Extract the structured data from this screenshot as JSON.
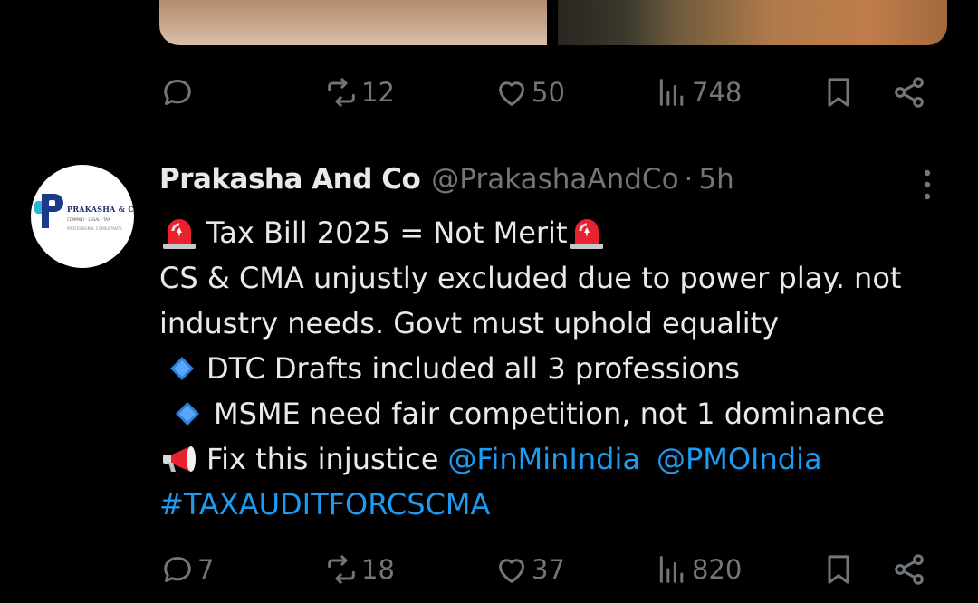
{
  "prev_tweet": {
    "actions": {
      "replies": "",
      "reposts": "12",
      "likes": "50",
      "views": "748"
    }
  },
  "tweet": {
    "avatar_text": {
      "name": "PRAKASHA & CO",
      "sub1": "COMPANY · LEGAL · TAX",
      "sub2": "PROFESSIONAL CONSULTANTS"
    },
    "author_name": "Prakasha And Co",
    "handle": "@PrakashaAndCo",
    "separator": "·",
    "time": "5h",
    "lines": {
      "l1": "Tax Bill 2025 = Not Merit",
      "l2": "CS & CMA unjustly excluded due to power play. not",
      "l3": "industry needs. Govt must uphold equality",
      "l4": "DTC Drafts included all 3 professions",
      "l5": "MSME need fair competition, not 1 dominance",
      "l6": "Fix this injustice",
      "mention1": "@FinMinIndia",
      "mention2": "@PMOIndia",
      "hashtag": "#TAXAUDITFORCSCMA"
    },
    "actions": {
      "replies": "7",
      "reposts": "18",
      "likes": "37",
      "views": "820"
    }
  },
  "icons": [
    "reply-icon",
    "repost-icon",
    "like-icon",
    "views-icon",
    "bookmark-icon",
    "share-icon",
    "more-icon",
    "siren-emoji",
    "diamond-emoji",
    "megaphone-emoji"
  ],
  "colors": {
    "background": "#000000",
    "text": "#e7e9ea",
    "muted": "#71767b",
    "link": "#1d9bf0",
    "divider": "#2f3336"
  }
}
